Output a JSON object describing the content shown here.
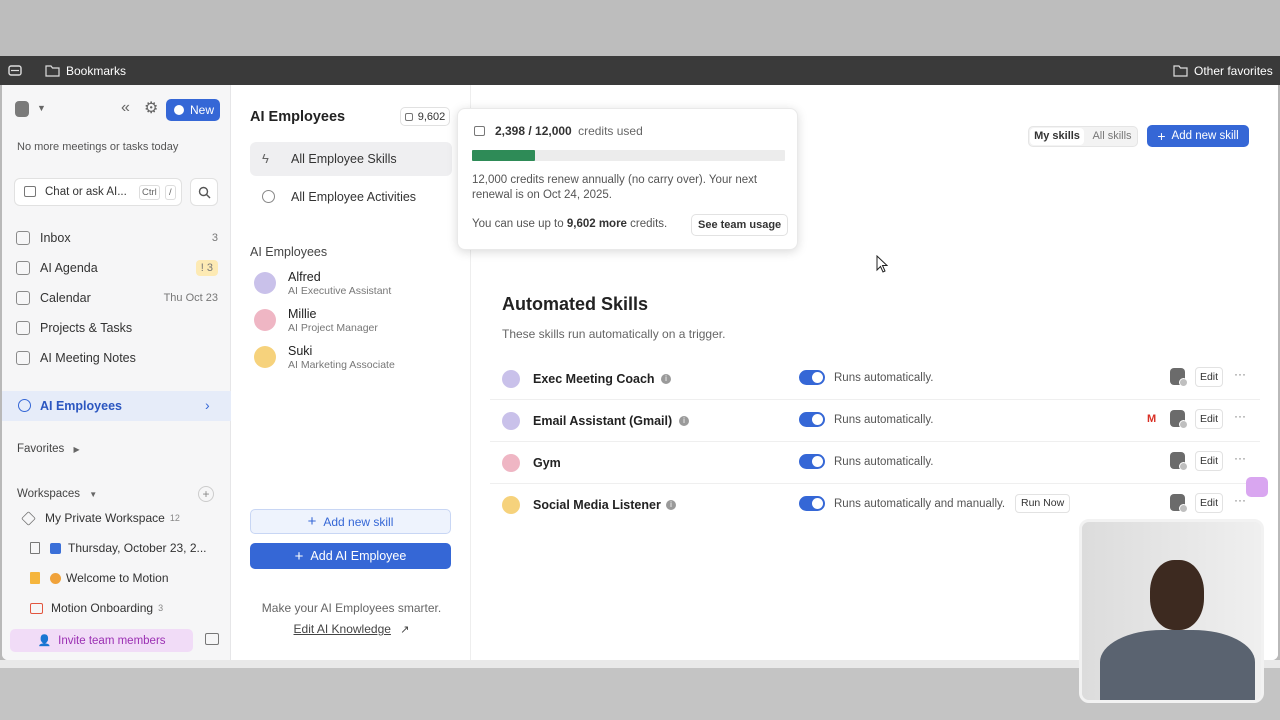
{
  "browser": {
    "bookmarks_label": "Bookmarks",
    "other_favorites_label": "Other favorites"
  },
  "sidebar": {
    "new_button": "New",
    "no_meetings": "No more meetings or tasks today",
    "chat_placeholder": "Chat or ask AI...",
    "chat_shortcut_ctrl": "Ctrl",
    "chat_shortcut_key": "/",
    "nav": [
      {
        "label": "Inbox",
        "right": "3"
      },
      {
        "label": "AI Agenda",
        "right": "3"
      },
      {
        "label": "Calendar",
        "right": "Thu Oct 23"
      },
      {
        "label": "Projects & Tasks",
        "right": ""
      },
      {
        "label": "AI Meeting Notes",
        "right": ""
      }
    ],
    "ai_employees": "AI Employees",
    "favorites": "Favorites",
    "workspaces": "Workspaces",
    "workspace_items": [
      {
        "label": "My Private Workspace",
        "count": "12"
      },
      {
        "label": "Thursday, October 23, 2...",
        "count": ""
      },
      {
        "label": "Welcome to Motion",
        "count": ""
      },
      {
        "label": "Motion Onboarding",
        "count": "3"
      }
    ],
    "invite": "Invite team members"
  },
  "middle": {
    "title": "AI Employees",
    "credits_badge": "9,602",
    "menu": [
      {
        "label": "All Employee Skills"
      },
      {
        "label": "All Employee Activities"
      }
    ],
    "section_label": "AI Employees",
    "employees": [
      {
        "name": "Alfred",
        "role": "AI Executive Assistant"
      },
      {
        "name": "Millie",
        "role": "AI Project Manager"
      },
      {
        "name": "Suki",
        "role": "AI Marketing Associate"
      }
    ],
    "add_skill": "Add new skill",
    "add_employee": "Add AI Employee",
    "footer_text": "Make your AI Employees smarter.",
    "footer_link": "Edit AI Knowledge"
  },
  "popover": {
    "credits_used": "2,398 / 12,000",
    "credits_used_suffix": "credits used",
    "progress": 0.1998,
    "renew_text": "12,000 credits renew annually (no carry over). Your next renewal is on Oct 24, 2025.",
    "can_use_prefix": "You can use up to",
    "can_use_amount": "9,602 more",
    "can_use_suffix": "credits.",
    "team_usage": "See team usage"
  },
  "main": {
    "tab_my": "My skills",
    "tab_all": "All skills",
    "add_skill": "Add new skill",
    "heading": "Automated Skills",
    "subheading": "These skills run automatically on a trigger.",
    "skills": [
      {
        "name": "Exec Meeting Coach",
        "status": "Runs automatically.",
        "edit": "Edit"
      },
      {
        "name": "Email Assistant (Gmail)",
        "status": "Runs automatically.",
        "edit": "Edit"
      },
      {
        "name": "Gym",
        "status": "Runs automatically.",
        "edit": "Edit"
      },
      {
        "name": "Social Media Listener",
        "status": "Runs automatically and manually.",
        "run_now": "Run Now",
        "edit": "Edit"
      }
    ]
  },
  "colors": {
    "accent": "#3567d6",
    "progress_fill": "#2e8b57",
    "sidebar_bg": "#f6f6f7",
    "invite_bg": "#f1dcf7"
  }
}
